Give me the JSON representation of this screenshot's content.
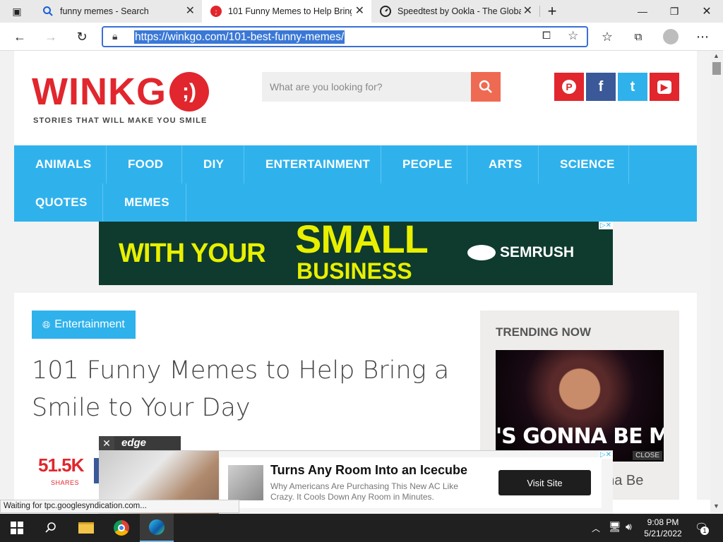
{
  "tabs": [
    {
      "title": "funny memes - Search",
      "active": false
    },
    {
      "title": "101 Funny Memes to Help Bring",
      "active": true
    },
    {
      "title": "Speedtest by Ookla - The Global",
      "active": false
    }
  ],
  "address": {
    "url": "https://winkgo.com/101-best-funny-memes/"
  },
  "site": {
    "logo": "WINKG",
    "logo_symbol": ";)",
    "tagline": "STORIES THAT WILL MAKE YOU SMILE",
    "search_placeholder": "What are you looking for?",
    "social": [
      {
        "name": "pinterest",
        "glyph": "P",
        "color": "#e1262d"
      },
      {
        "name": "facebook",
        "glyph": "f",
        "color": "#3b5998"
      },
      {
        "name": "twitter",
        "glyph": "t",
        "color": "#2fb2ec"
      },
      {
        "name": "youtube",
        "glyph": "▶",
        "color": "#e1262d"
      }
    ]
  },
  "nav": {
    "row1": [
      "ANIMALS",
      "FOOD",
      "DIY",
      "ENTERTAINMENT",
      "PEOPLE",
      "ARTS",
      "SCIENCE"
    ],
    "row2": [
      "QUOTES",
      "MEMES"
    ]
  },
  "ad_top": {
    "line1": "WITH YOUR",
    "line2": "SMALL",
    "line3": "BUSINESS",
    "brand": "SEMRUSH"
  },
  "article": {
    "category": "Entertainment",
    "title": "101 Funny Memes to Help Bring a Smile to Your Day",
    "shares_count": "51.5K",
    "shares_label": "SHARES"
  },
  "trending": {
    "heading": "TRENDING NOW",
    "caption": "'S GONNA BE MA",
    "close_label": "CLOSE",
    "item_text": "nna Be"
  },
  "ad_bottom": {
    "tag": "edge",
    "headline": "Turns Any Room Into an Icecube",
    "body": "Why Americans Are Purchasing This New AC Like Crazy. It Cools Down Any Room in Minutes.",
    "cta": "Visit Site"
  },
  "status": {
    "text": "Waiting for tpc.googlesyndication.com..."
  },
  "taskbar": {
    "time": "9:08 PM",
    "date": "5/21/2022",
    "notifications": "1"
  }
}
